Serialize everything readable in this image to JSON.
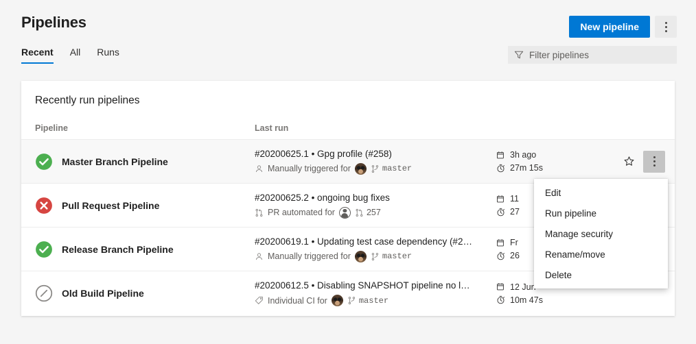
{
  "header": {
    "title": "Pipelines",
    "new_pipeline_label": "New pipeline",
    "more_actions_label": "More actions"
  },
  "tabs": [
    {
      "label": "Recent",
      "active": true
    },
    {
      "label": "All",
      "active": false
    },
    {
      "label": "Runs",
      "active": false
    }
  ],
  "filter": {
    "placeholder": "Filter pipelines",
    "value": "",
    "icon": "funnel-icon"
  },
  "card": {
    "title": "Recently run pipelines",
    "columns": {
      "pipeline": "Pipeline",
      "last_run": "Last run"
    }
  },
  "rows": [
    {
      "status": "succeeded",
      "status_icon": "check-circle-green-icon",
      "name": "Master Branch Pipeline",
      "run_title": "#20200625.1 • Gpg profile (#258)",
      "trigger_icon": "person-icon",
      "trigger_label": "Manually triggered for",
      "avatar": "photo",
      "ref_icon": "branch-icon",
      "ref_label": "master",
      "ref_mono": true,
      "time_ago": "3h ago",
      "duration": "27m 15s",
      "hovered": true
    },
    {
      "status": "failed",
      "status_icon": "x-circle-red-icon",
      "name": "Pull Request Pipeline",
      "run_title": "#20200625.2 • ongoing bug fixes",
      "trigger_icon": "pull-request-icon",
      "trigger_label": "PR automated for",
      "avatar": "generic",
      "ref_icon": "pull-request-icon",
      "ref_label": "257",
      "ref_mono": false,
      "time_ago": "11",
      "duration": "27",
      "hovered": false
    },
    {
      "status": "succeeded",
      "status_icon": "check-circle-green-icon",
      "name": "Release Branch Pipeline",
      "run_title": "#20200619.1 • Updating test case dependency (#2…",
      "trigger_icon": "person-icon",
      "trigger_label": "Manually triggered for",
      "avatar": "photo",
      "ref_icon": "branch-icon",
      "ref_label": "master",
      "ref_mono": true,
      "time_ago": "Fr",
      "duration": "26",
      "hovered": false
    },
    {
      "status": "canceled",
      "status_icon": "canceled-circle-icon",
      "name": "Old Build Pipeline",
      "run_title": "#20200612.5 • Disabling SNAPSHOT pipeline no l…",
      "trigger_icon": "tag-icon",
      "trigger_label": "Individual CI for",
      "avatar": "photo",
      "ref_icon": "branch-icon",
      "ref_label": "master",
      "ref_mono": true,
      "time_ago": "12 Jun",
      "duration": "10m 47s",
      "hovered": false
    }
  ],
  "context_menu": {
    "items": [
      {
        "label": "Edit"
      },
      {
        "label": "Run pipeline"
      },
      {
        "label": "Manage security"
      },
      {
        "label": "Rename/move"
      },
      {
        "label": "Delete"
      }
    ]
  },
  "colors": {
    "accent": "#0078d4",
    "success": "#4caf50",
    "error": "#d64541",
    "canceled": "#8a8886",
    "page_bg": "#f5f5f5"
  }
}
